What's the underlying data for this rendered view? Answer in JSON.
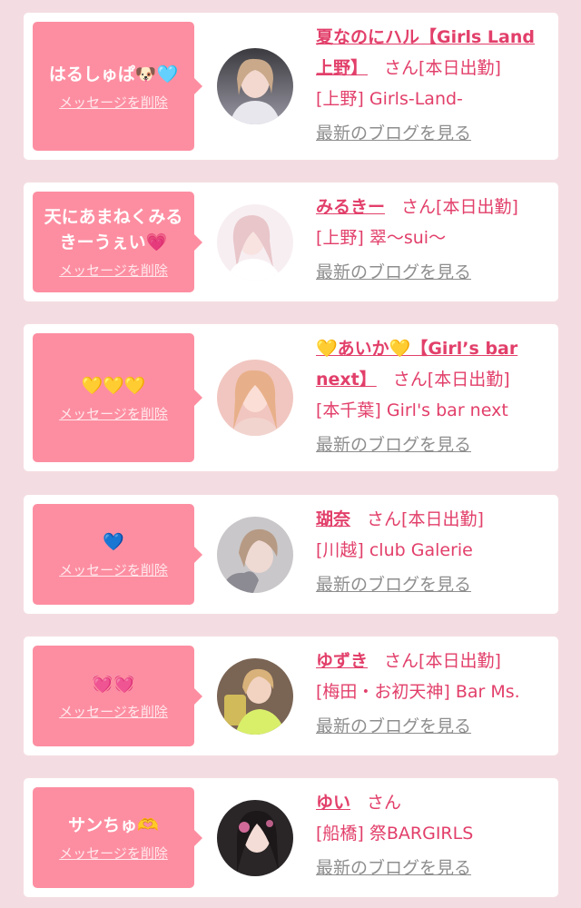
{
  "entries": [
    {
      "bubble_text": "はるしゅぱ🐶🩵",
      "delete_label": "メッセージを削除",
      "name": "夏なのにハル【Girls Land上野】",
      "honorific": "さん",
      "status": "[本日出勤]",
      "shop": "[上野] Girls-Land-",
      "blog_label": "最新のブログを見る",
      "avatar_icon": "profile-photo"
    },
    {
      "bubble_text": "天にあまねくみるきーうぇい💗",
      "delete_label": "メッセージを削除",
      "name": "みるきー",
      "honorific": "さん",
      "status": "[本日出勤]",
      "shop": "[上野] 翠〜sui〜",
      "blog_label": "最新のブログを見る",
      "avatar_icon": "profile-photo"
    },
    {
      "bubble_text": "💛💛💛",
      "delete_label": "メッセージを削除",
      "name": "💛あいか💛【Girl’s bar next】",
      "honorific": "さん",
      "status": "[本日出勤]",
      "shop": "[本千葉] Girl's bar next",
      "blog_label": "最新のブログを見る",
      "avatar_icon": "profile-photo"
    },
    {
      "bubble_text": "💙",
      "delete_label": "メッセージを削除",
      "name": "瑚奈",
      "honorific": "さん",
      "status": "[本日出勤]",
      "shop": "[川越] club Galerie",
      "blog_label": "最新のブログを見る",
      "avatar_icon": "profile-photo"
    },
    {
      "bubble_text": "💓💓",
      "delete_label": "メッセージを削除",
      "name": "ゆずき",
      "honorific": "さん",
      "status": "[本日出勤]",
      "shop": "[梅田・お初天神] Bar Ms.",
      "blog_label": "最新のブログを見る",
      "avatar_icon": "profile-photo"
    },
    {
      "bubble_text": "サンちゅ🫶",
      "delete_label": "メッセージを削除",
      "name": "ゆい",
      "honorific": "さん",
      "status": "",
      "shop": "[船橋] 祭BARGIRLS",
      "blog_label": "最新のブログを見る",
      "avatar_icon": "profile-photo"
    }
  ],
  "colors": {
    "background": "#f4dde2",
    "card": "#ffffff",
    "bubble": "#fd8ea1",
    "accent": "#e23f6a",
    "muted_link": "#8e8e8e"
  }
}
